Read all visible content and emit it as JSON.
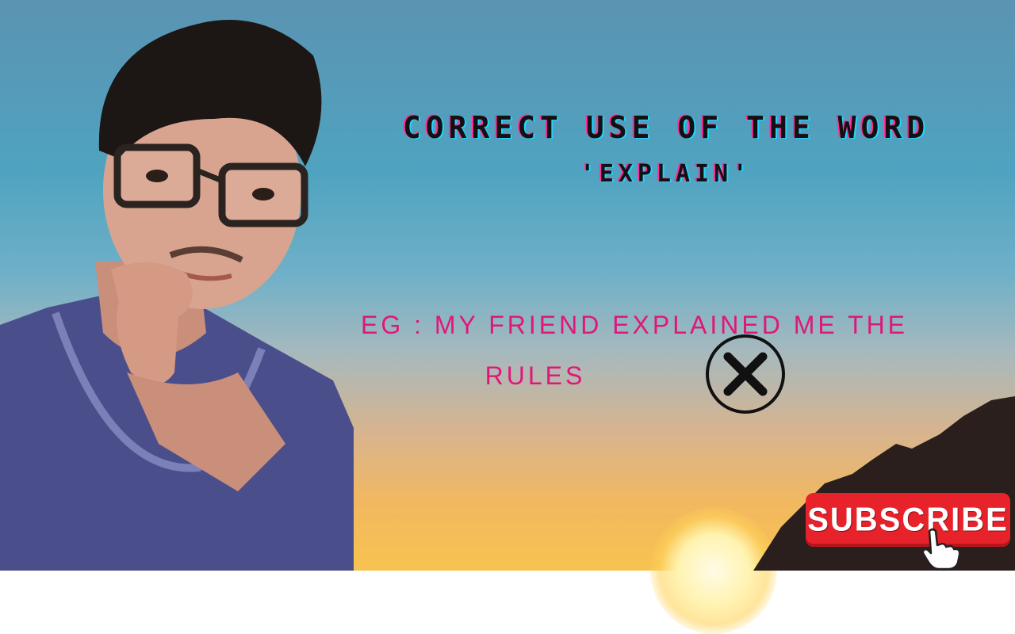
{
  "title": {
    "line1": "CORRECT USE OF THE WORD",
    "line2": "'EXPLAIN'"
  },
  "example": {
    "line1": "EG : MY FRIEND EXPLAINED ME THE",
    "line2": "RULES"
  },
  "subscribe_button": {
    "label": "SUBSCRIBE"
  },
  "icons": {
    "wrong": "x-circle-icon",
    "cursor": "hand-pointer-icon"
  },
  "colors": {
    "example_text": "#e0177a",
    "subscribe_bg": "#e8222a",
    "title_text": "#111111"
  }
}
